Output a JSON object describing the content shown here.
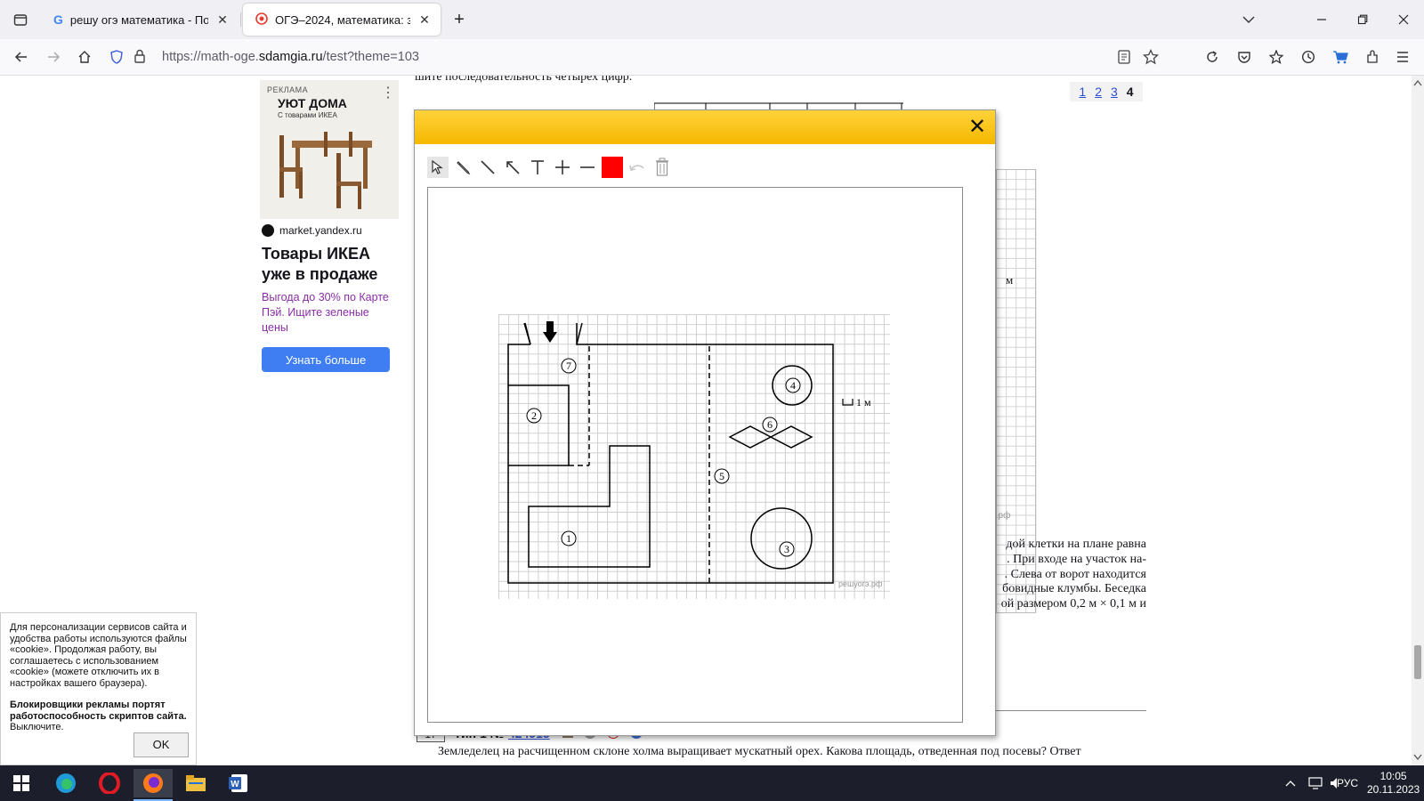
{
  "browser": {
    "tabs": [
      {
        "title": "решу огэ математика - Поиск",
        "close": "✕",
        "active": false
      },
      {
        "title": "ОГЭ–2024, математика: задани",
        "close": "✕",
        "active": true
      }
    ],
    "new_tab": "+",
    "url_host_prefix": "https://math-oge.",
    "url_host": "sdamgia.ru",
    "url_path": "/test?theme=103"
  },
  "page": {
    "top_text": "шите последовательность четырех цифр.",
    "pager": [
      "1",
      "2",
      "3",
      "4"
    ],
    "bg_label_m": "м",
    "bg_watermark": "решуогэ.рф",
    "bg_text_lines": [
      "дой клетки на плане равна",
      ". При входе на участок на-",
      ". Слева от ворот находится",
      "бовидные клумбы. Беседка",
      "ой размером 0,2 м × 0,1 м и"
    ],
    "task": {
      "number": "17",
      "type_label": "Тип 1 №",
      "task_id": "424915",
      "text": "Земледелец на расчищенном склоне холма выращивает мускатный орех. Какова площадь, отведенная под посевы? Ответ"
    }
  },
  "ad": {
    "label": "РЕКЛАМА",
    "headline_small": "УЮТ ДОМА",
    "sub_small": "С товарами ИКЕА",
    "source": "market.yandex.ru",
    "title": "Товары ИКЕА уже в продаже",
    "promo": "Выгода до 30% по Карте Пэй. Ищите зеленые цены",
    "cta": "Узнать больше"
  },
  "dialog": {
    "close": "✕",
    "selected_color": "#ff0000",
    "plan": {
      "scale_label": "1 м",
      "watermark": "решуогэ.рф",
      "labels": [
        "1",
        "2",
        "3",
        "4",
        "5",
        "6",
        "7"
      ]
    }
  },
  "cookie": {
    "text": "Для персонализации сервисов сайта и удобства работы используются файлы «cookie». Продолжая работу, вы соглашаетесь с использованием «cookie» (можете отключить их в настройках вашего браузера).",
    "warning_bold": "Блокировщики рекламы портят работоспособность скриптов сайта.",
    "warning_tail": "Выключите.",
    "ok": "OK"
  },
  "taskbar": {
    "lang": "РУС",
    "time": "10:05",
    "date": "20.11.2023"
  },
  "colors": {
    "accent_yellow": "#f5b800",
    "link": "#2a4fd1",
    "cta": "#3f7ef2"
  }
}
